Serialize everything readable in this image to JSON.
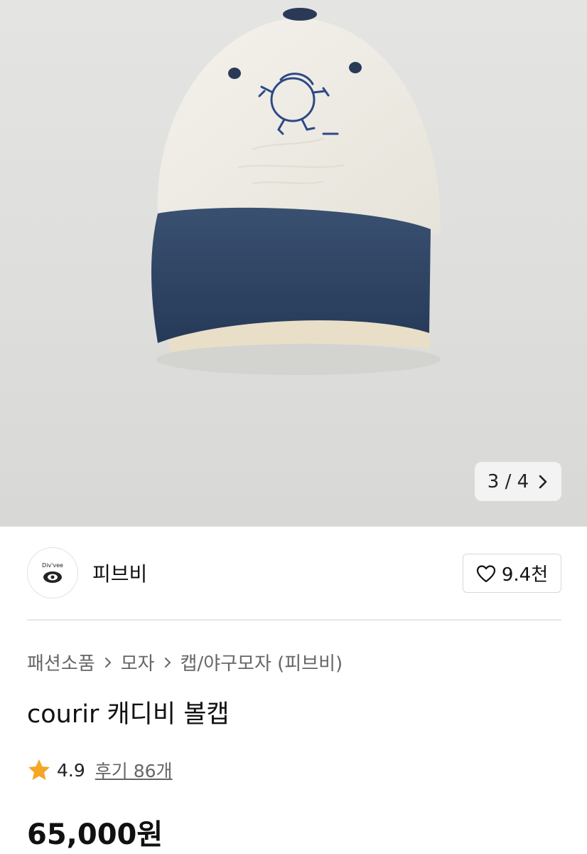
{
  "gallery": {
    "current": "3",
    "total": "4",
    "separator": "/",
    "next_icon": "chevron-right-icon"
  },
  "seller": {
    "name": "피브비",
    "logo_text": "Div'vee",
    "likes": "9.4천"
  },
  "breadcrumb": [
    "패션소품",
    "모자",
    "캡/야구모자 (피브비)"
  ],
  "product": {
    "title": "courir 캐디비 볼캡",
    "rating": "4.9",
    "reviews": "후기 86개",
    "price": "65,000원"
  },
  "colors": {
    "cap_navy": "#2f4566",
    "cap_cream": "#efece4",
    "star": "#f5a623"
  }
}
